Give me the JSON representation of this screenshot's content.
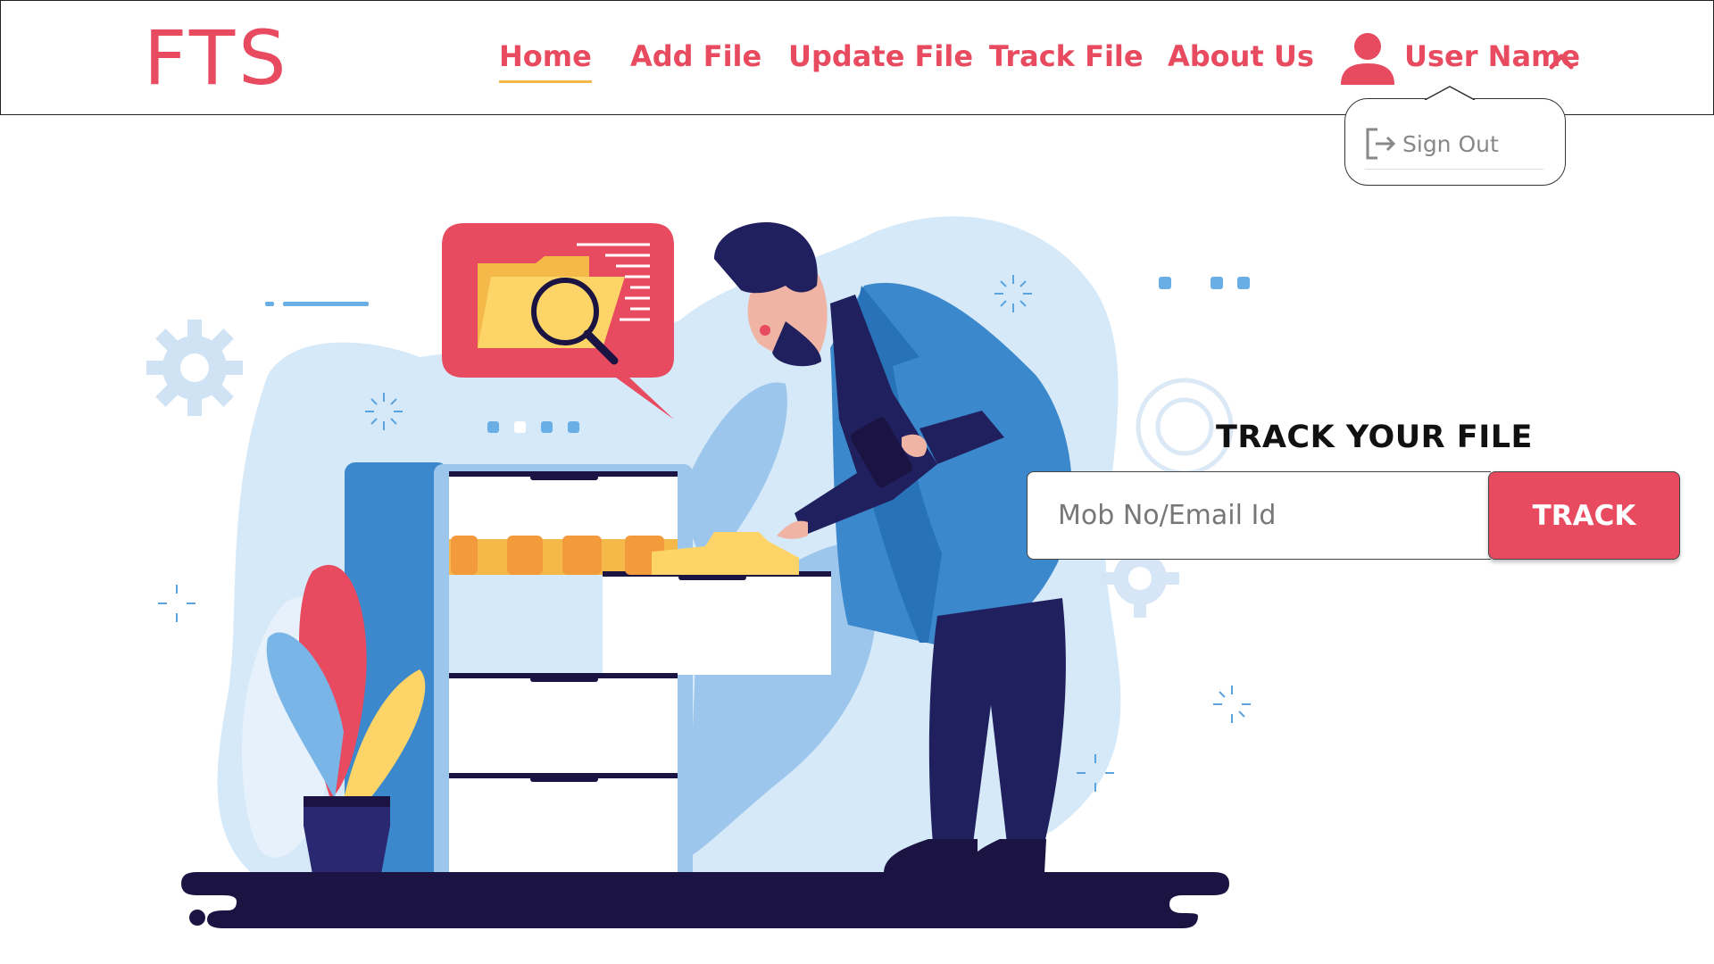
{
  "brand": {
    "logo": "FTS",
    "accent": "#e84a5f",
    "underline": "#f5b94a"
  },
  "nav": {
    "items": [
      {
        "label": "Home",
        "active": true
      },
      {
        "label": "Add File",
        "active": false
      },
      {
        "label": "Update File",
        "active": false
      },
      {
        "label": "Track File",
        "active": false
      },
      {
        "label": "About Us",
        "active": false
      }
    ]
  },
  "user": {
    "name": "User Name",
    "icon": "user-icon",
    "menu_icon": "chevron-up-icon"
  },
  "dropdown": {
    "items": [
      {
        "label": "Sign Out",
        "icon": "sign-out-icon"
      }
    ]
  },
  "track": {
    "title": "TRACK YOUR FILE",
    "placeholder": "Mob No/Email Id",
    "value": "",
    "button_label": "TRACK"
  }
}
